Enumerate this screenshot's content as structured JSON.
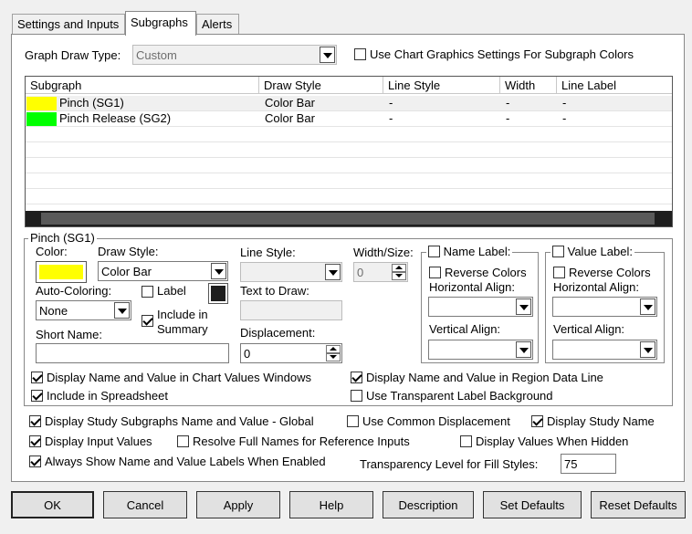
{
  "tabs": [
    "Settings and Inputs",
    "Subgraphs",
    "Alerts"
  ],
  "graph_draw_type": {
    "label": "Graph Draw Type:",
    "value": "Custom"
  },
  "use_chart_graphics": {
    "label": "Use Chart Graphics Settings For Subgraph Colors",
    "checked": false
  },
  "grid": {
    "headers": [
      "Subgraph",
      "Draw Style",
      "Line Style",
      "Width",
      "Line Label"
    ],
    "rows": [
      {
        "color": "#ffff00",
        "name": "Pinch (SG1)",
        "draw_style": "Color Bar",
        "line_style": "-",
        "width": "-",
        "line_label": "-"
      },
      {
        "color": "#00ff00",
        "name": "Pinch Release (SG2)",
        "draw_style": "Color Bar",
        "line_style": "-",
        "width": "-",
        "line_label": "-"
      }
    ]
  },
  "detail": {
    "group_title": "Pinch (SG1)",
    "color_label": "Color:",
    "color_value": "#ffff00",
    "draw_style_label": "Draw Style:",
    "draw_style_value": "Color Bar",
    "line_style_label": "Line Style:",
    "width_label": "Width/Size:",
    "width_value": "0",
    "auto_coloring_label": "Auto-Coloring:",
    "auto_coloring_value": "None",
    "label_chk": "Label",
    "include_summary": "Include in Summary",
    "text_to_draw_label": "Text to Draw:",
    "short_name_label": "Short Name:",
    "displacement_label": "Displacement:",
    "displacement_value": "0",
    "name_label": {
      "title": "Name Label:",
      "reverse": "Reverse Colors",
      "h_align": "Horizontal Align:",
      "v_align": "Vertical Align:"
    },
    "value_label": {
      "title": "Value Label:",
      "reverse": "Reverse Colors",
      "h_align": "Horizontal Align:",
      "v_align": "Vertical Align:"
    },
    "display_chart_values": "Display Name and Value in Chart Values Windows",
    "display_region_data": "Display Name and Value in Region Data Line",
    "include_spreadsheet": "Include in Spreadsheet",
    "transparent_label_bg": "Use Transparent Label Background"
  },
  "global": {
    "display_study_subgraphs": "Display Study Subgraphs Name and Value - Global",
    "use_common_displacement": "Use Common Displacement",
    "display_study_name": "Display Study Name",
    "display_input_values": "Display Input Values",
    "resolve_full_names": "Resolve Full Names for Reference Inputs",
    "display_values_hidden": "Display Values When Hidden",
    "always_show_labels": "Always Show Name and Value Labels When Enabled",
    "transparency_label": "Transparency Level for Fill Styles:",
    "transparency_value": "75"
  },
  "buttons": [
    "OK",
    "Cancel",
    "Apply",
    "Help",
    "Description",
    "Set Defaults",
    "Reset Defaults"
  ]
}
